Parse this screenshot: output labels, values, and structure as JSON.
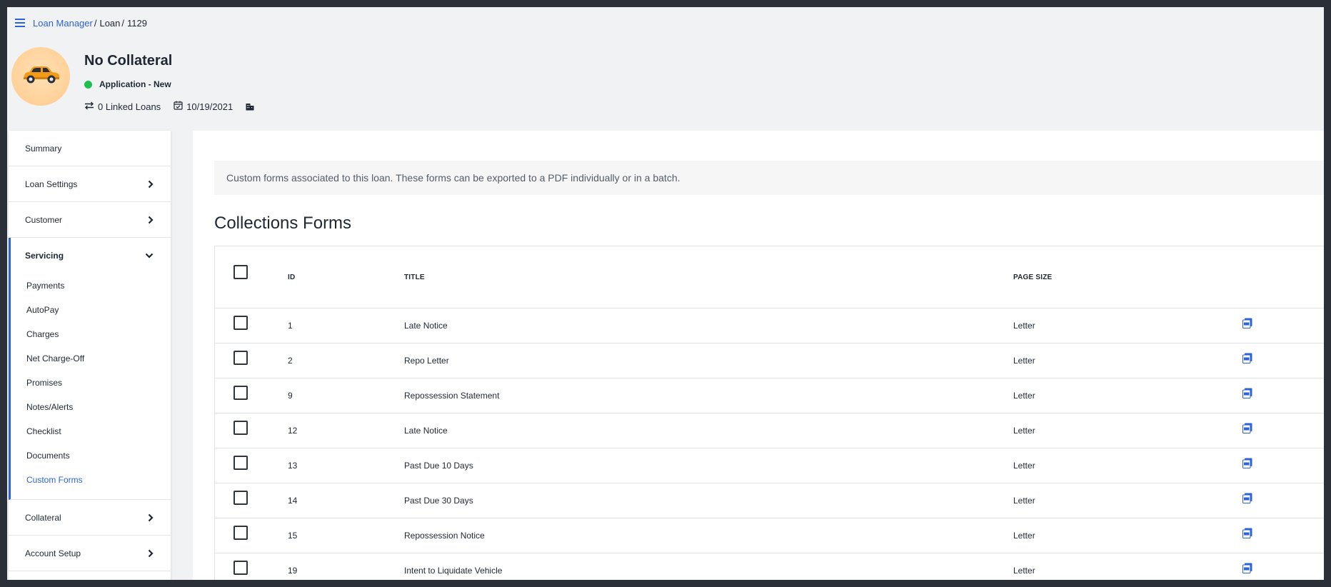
{
  "breadcrumb": {
    "link": "Loan Manager",
    "sep1": "/",
    "loan": "Loan",
    "sep2": "/",
    "id": "1129"
  },
  "header": {
    "title": "No Collateral",
    "status": "Application - New",
    "status_color": "#1fbf4f",
    "linked_loans": "0 Linked Loans",
    "date": "10/19/2021"
  },
  "sidebar": {
    "summary": "Summary",
    "loan_settings": "Loan Settings",
    "customer": "Customer",
    "servicing": "Servicing",
    "servicing_items": [
      "Payments",
      "AutoPay",
      "Charges",
      "Net Charge-Off",
      "Promises",
      "Notes/Alerts",
      "Checklist",
      "Documents",
      "Custom Forms"
    ],
    "collateral": "Collateral",
    "account_setup": "Account Setup"
  },
  "main": {
    "info": "Custom forms associated to this loan. These forms can be exported to a PDF individually or in a batch.",
    "section_title": "Collections Forms",
    "columns": {
      "id": "ID",
      "title": "TITLE",
      "page_size": "PAGE SIZE"
    },
    "rows": [
      {
        "id": "1",
        "title": "Late Notice",
        "page_size": "Letter"
      },
      {
        "id": "2",
        "title": "Repo Letter",
        "page_size": "Letter"
      },
      {
        "id": "9",
        "title": "Repossession Statement",
        "page_size": "Letter"
      },
      {
        "id": "12",
        "title": "Late Notice",
        "page_size": "Letter"
      },
      {
        "id": "13",
        "title": "Past Due 10 Days",
        "page_size": "Letter"
      },
      {
        "id": "14",
        "title": "Past Due 30 Days",
        "page_size": "Letter"
      },
      {
        "id": "15",
        "title": "Repossession Notice",
        "page_size": "Letter"
      },
      {
        "id": "19",
        "title": "Intent to Liquidate Vehicle",
        "page_size": "Letter"
      }
    ]
  },
  "icons": {
    "menu": "hamburger-menu-icon",
    "avatar": "car-icon",
    "linked": "exchange-arrows-icon",
    "date": "calendar-check-icon",
    "extra": "building-icon",
    "row_action": "pdf-file-icon"
  },
  "colors": {
    "accent": "#2d63d8",
    "status": "#1fbf4f"
  }
}
